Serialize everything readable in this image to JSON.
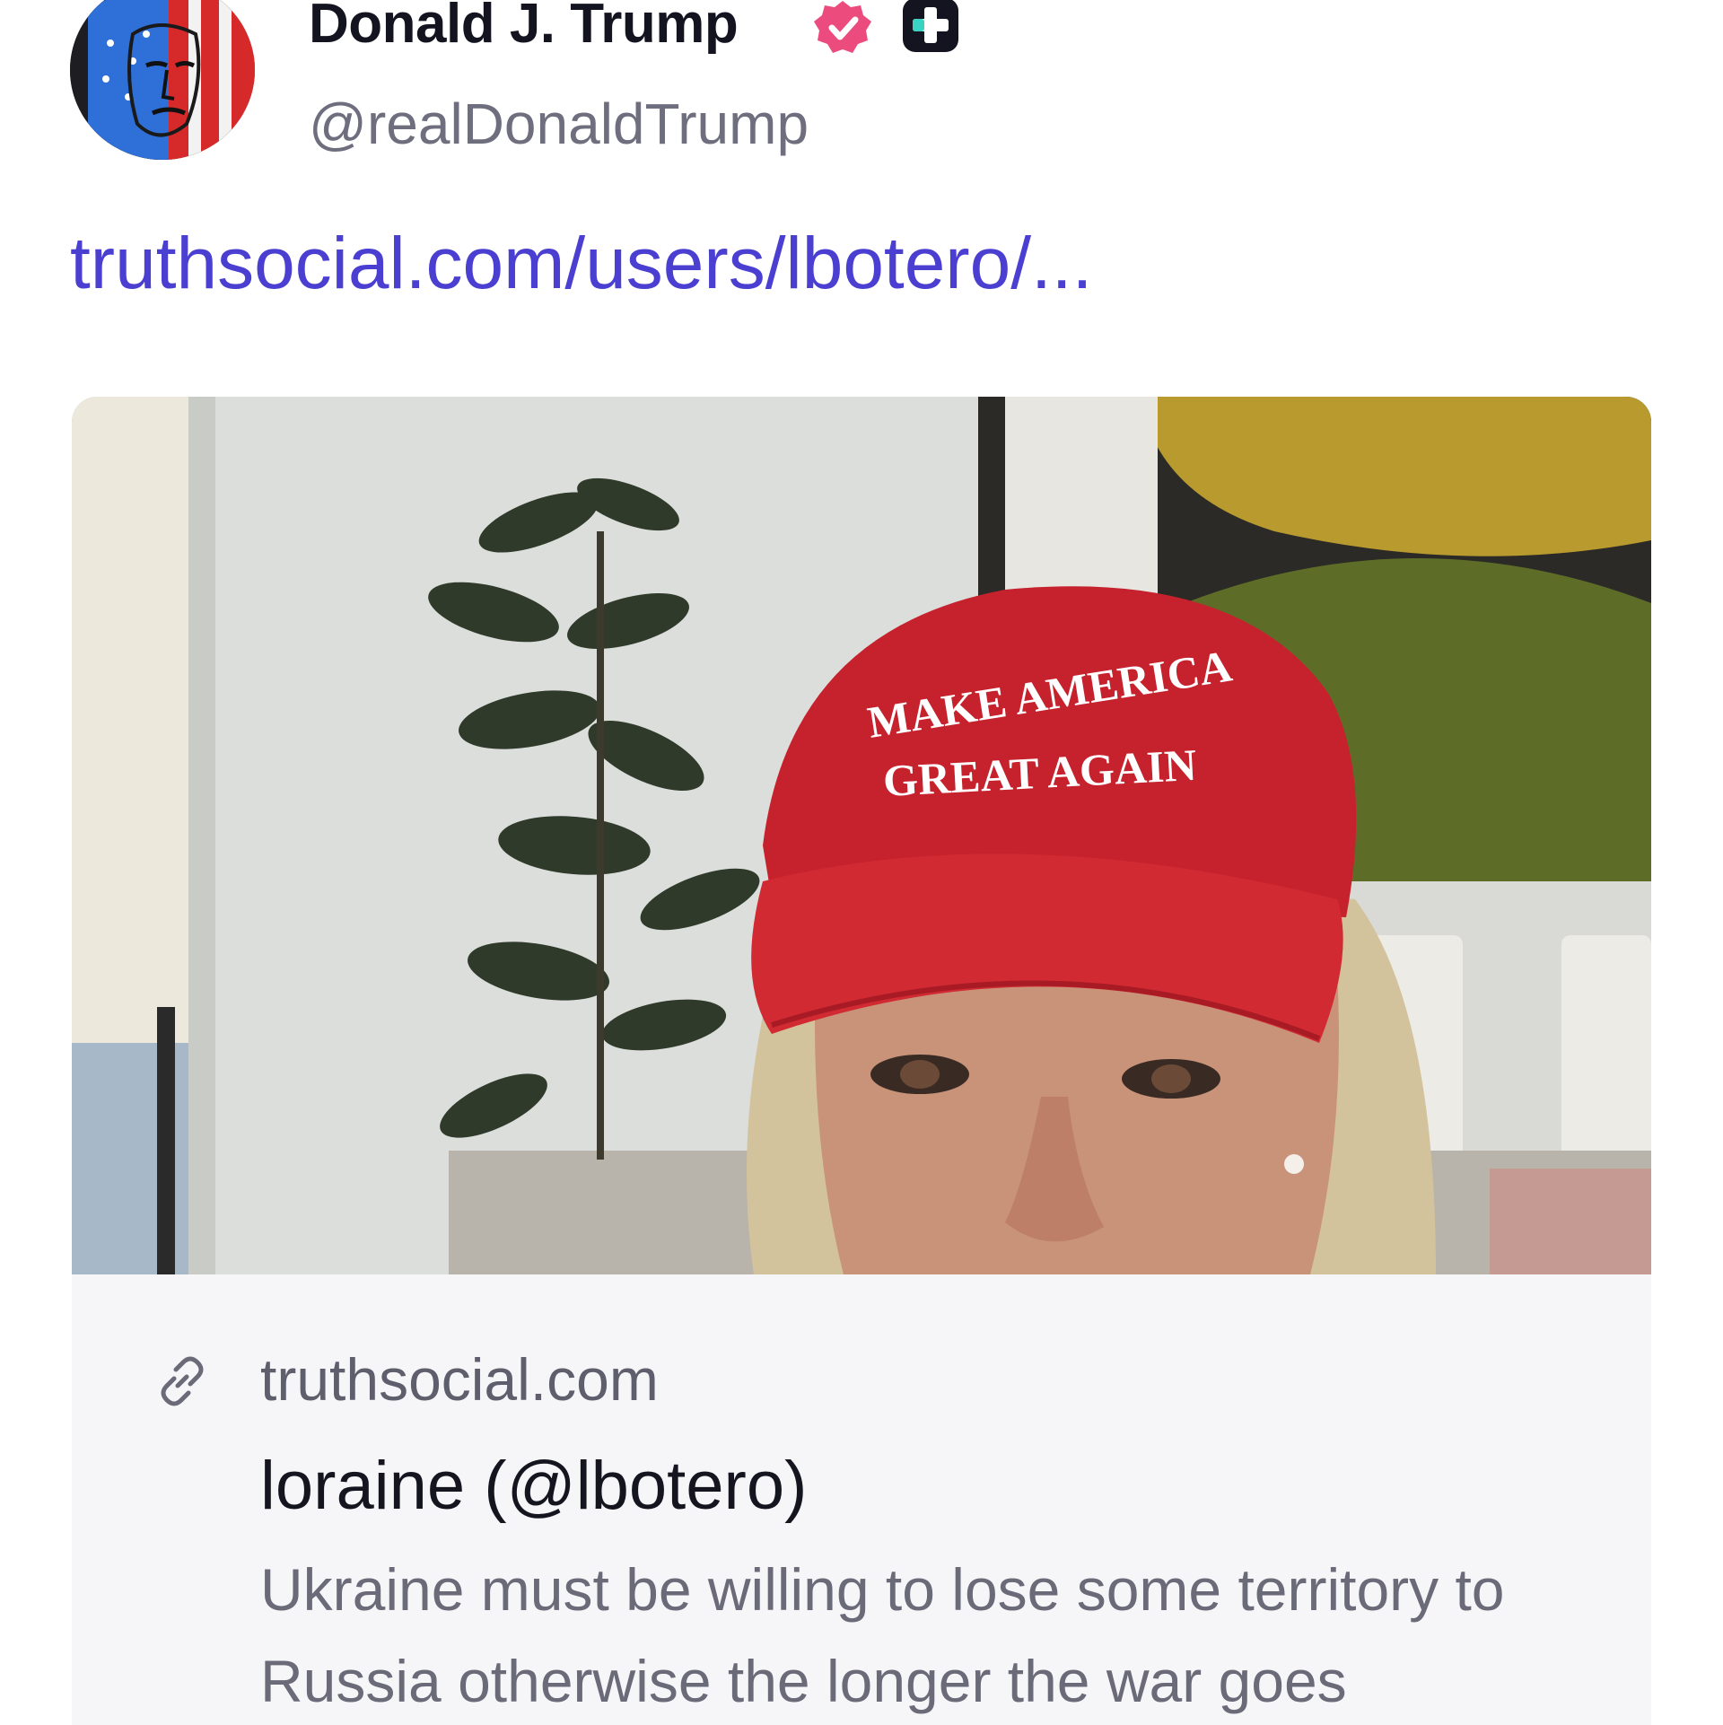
{
  "post": {
    "author": {
      "display_name": "Donald J. Trump",
      "handle": "@realDonaldTrump",
      "avatar_icon": "flag-painted-portrait-avatar",
      "verified_icon": "verified-badge-icon",
      "verified_color": "#ec4c7d",
      "plus_icon": "plus-badge-icon"
    },
    "link_text": "truthsocial.com/users/lbotero/...",
    "link_color": "#4a3fd0",
    "link_card": {
      "image_description_icon": "preview-photo",
      "hat_text_line1": "MAKE AMERICA",
      "hat_text_line2": "GREAT AGAIN",
      "link_icon": "link-icon",
      "domain": "truthsocial.com",
      "title": "loraine (@lbotero)",
      "description": "Ukraine must be willing to lose some territory to Russia otherwise the longer the war goes"
    }
  }
}
